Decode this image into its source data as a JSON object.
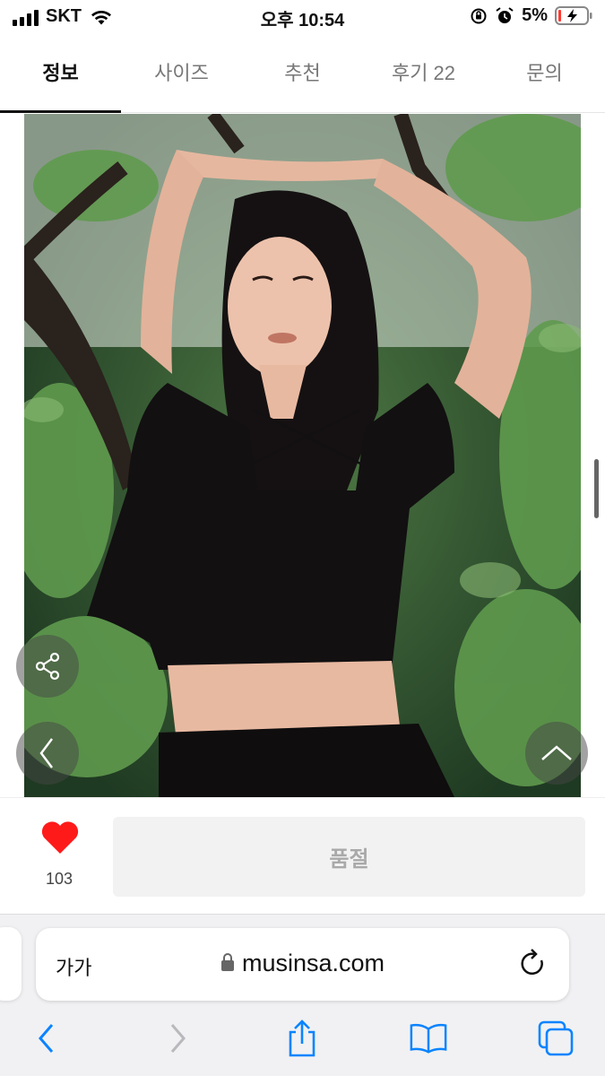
{
  "status_bar": {
    "carrier": "SKT",
    "time": "오후 10:54",
    "battery": "5%"
  },
  "tabs": [
    {
      "label": "정보",
      "active": true
    },
    {
      "label": "사이즈",
      "active": false
    },
    {
      "label": "추천",
      "active": false
    },
    {
      "label": "후기 22",
      "active": false
    },
    {
      "label": "문의",
      "active": false
    }
  ],
  "photo": {
    "icon": "product-photo"
  },
  "purchase": {
    "like_count": "103",
    "sold_out_label": "품절",
    "heart_color": "#ff1a1a"
  },
  "safari": {
    "text_size_label": "가가",
    "url": "musinsa.com"
  },
  "colors": {
    "accent": "#111111",
    "disabled_bg": "#f2f2f2",
    "disabled_text": "#a9a9a9",
    "ios_blue": "#0a84ff"
  }
}
